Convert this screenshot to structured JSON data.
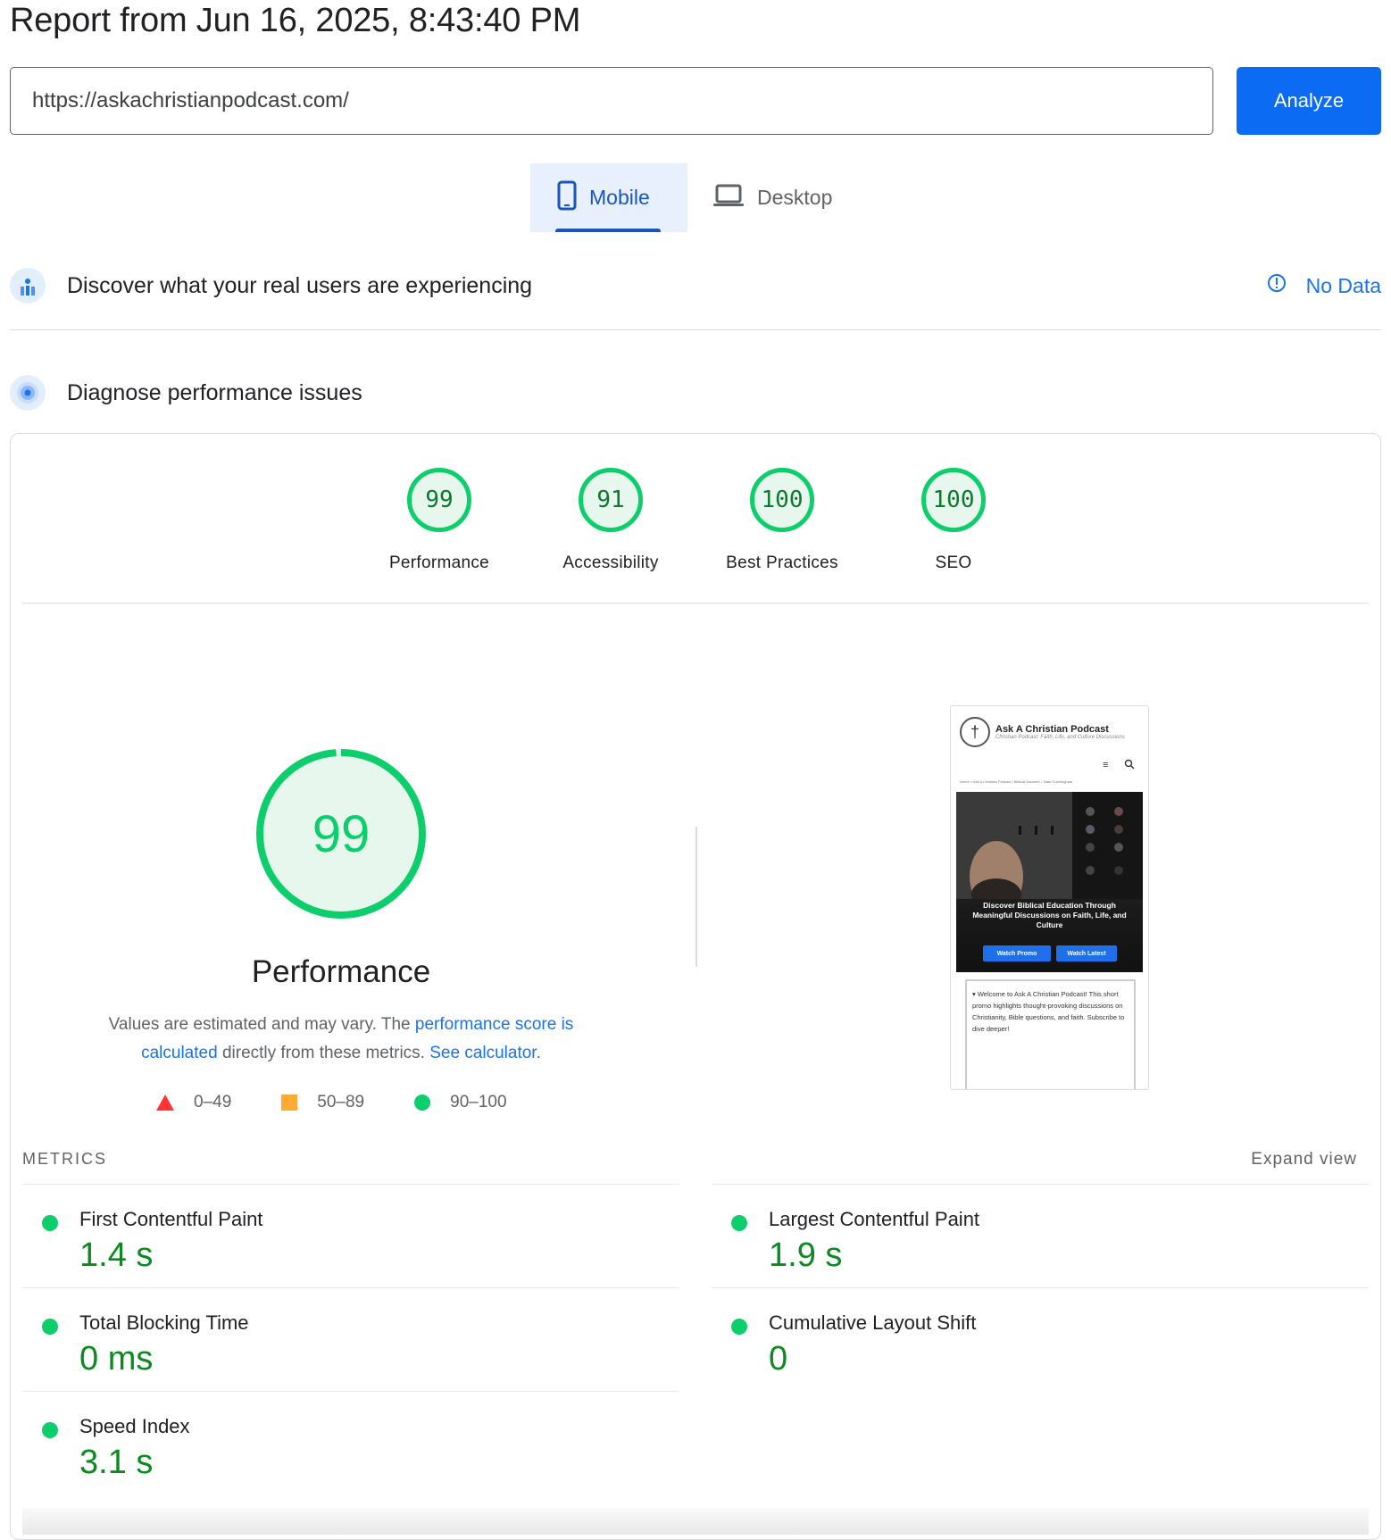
{
  "report": {
    "title": "Report from Jun 16, 2025, 8:43:40 PM"
  },
  "search": {
    "url": "https://askachristianpodcast.com/",
    "analyze_label": "Analyze"
  },
  "tabs": [
    {
      "label": "Mobile",
      "icon": "phone-icon",
      "active": true
    },
    {
      "label": "Desktop",
      "icon": "laptop-icon",
      "active": false
    }
  ],
  "field_data": {
    "heading": "Discover what your real users are experiencing",
    "status": "No Data"
  },
  "lab_data": {
    "heading": "Diagnose performance issues"
  },
  "categories": [
    {
      "score": "99",
      "label": "Performance"
    },
    {
      "score": "91",
      "label": "Accessibility"
    },
    {
      "score": "100",
      "label": "Best Practices"
    },
    {
      "score": "100",
      "label": "SEO"
    }
  ],
  "performance": {
    "score": "99",
    "score_value": 99,
    "title": "Performance",
    "desc_1": "Values are estimated and may vary. The ",
    "link_1": "performance score is calculated",
    "desc_2": " directly from these metrics. ",
    "link_2": "See calculator."
  },
  "legend": [
    {
      "shape": "triangle",
      "range": "0–49",
      "color": "#ff3333"
    },
    {
      "shape": "square",
      "range": "50–89",
      "color": "#ffaa33"
    },
    {
      "shape": "circle",
      "range": "90–100",
      "color": "#0cce6b"
    }
  ],
  "screenshot": {
    "site_title": "Ask A Christian Podcast",
    "tagline": "Christian Podcast: Faith, Life, and Culture Discussions",
    "breadcrumb": "Home » Ask A Christian Podcast | Biblical Answers – Nate Cunningham",
    "hero_text": "Discover Biblical Education Through Meaningful Discussions on Faith, Life, and Culture",
    "btn_promo": "Watch Promo",
    "btn_latest": "Watch Latest",
    "box_text": "▾ Welcome to Ask A Christian Podcast! This short promo highlights thought-provoking discussions on Christianity, Bible questions, and faith. Subscribe to dive deeper!"
  },
  "metrics": {
    "label": "METRICS",
    "expand_label": "Expand view",
    "items": [
      {
        "name": "First Contentful Paint",
        "value": "1.4 s"
      },
      {
        "name": "Largest Contentful Paint",
        "value": "1.9 s"
      },
      {
        "name": "Total Blocking Time",
        "value": "0 ms"
      },
      {
        "name": "Cumulative Layout Shift",
        "value": "0"
      },
      {
        "name": "Speed Index",
        "value": "3.1 s"
      }
    ]
  },
  "colors": {
    "accent": "#1a73e8",
    "pass": "#0cce6b",
    "pass_text": "#0b8a1f"
  }
}
